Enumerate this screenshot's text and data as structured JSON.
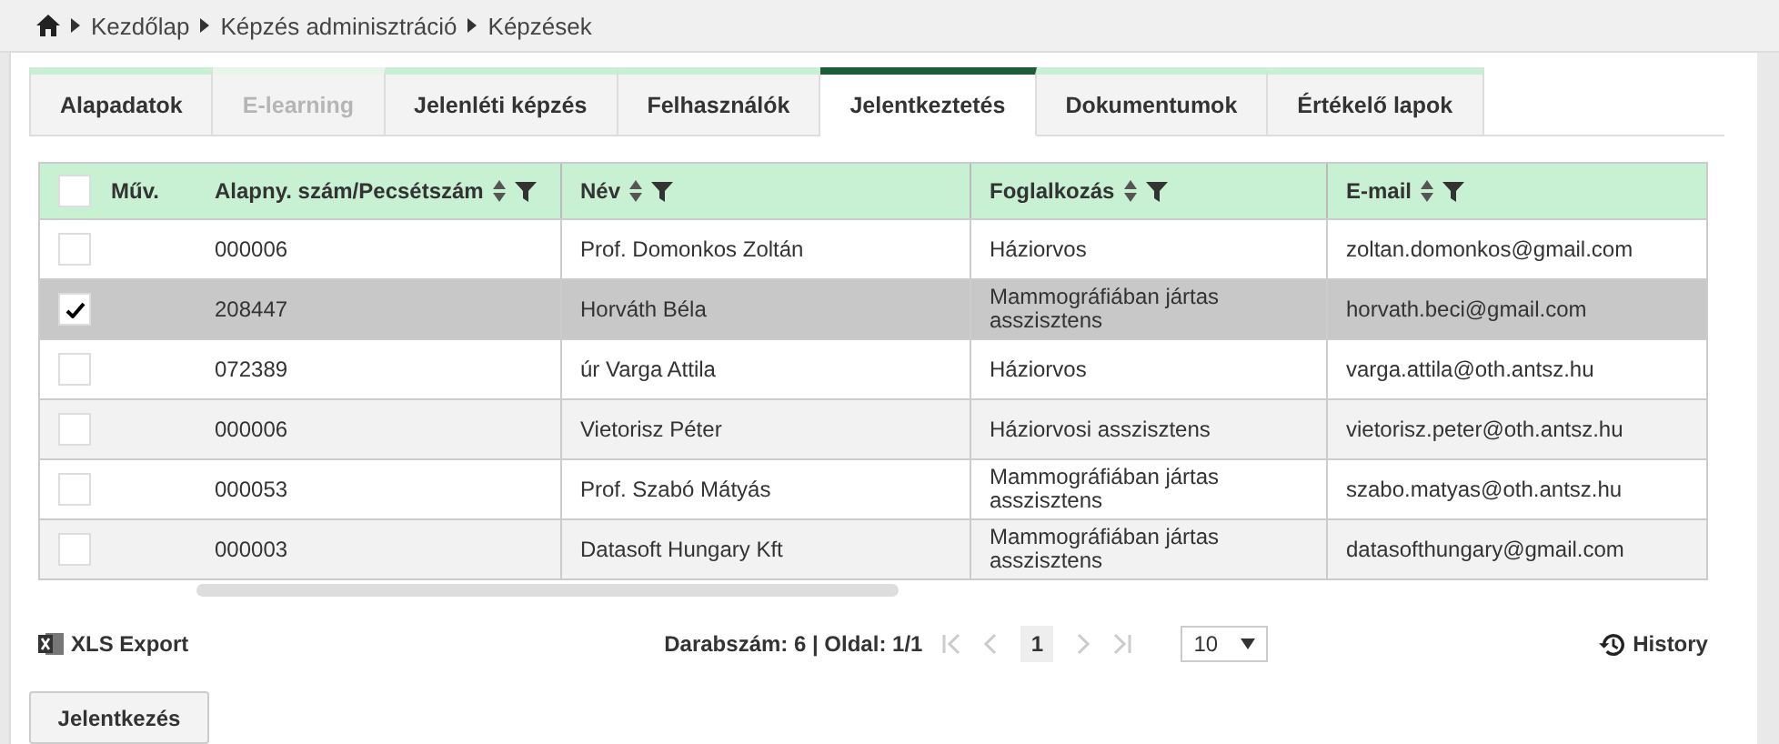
{
  "breadcrumb": [
    "Kezdőlap",
    "Képzés adminisztráció",
    "Képzések"
  ],
  "tabs": [
    {
      "label": "Alapadatok",
      "selected": false,
      "disabled": false
    },
    {
      "label": "E-learning",
      "selected": false,
      "disabled": true
    },
    {
      "label": "Jelenléti képzés",
      "selected": false,
      "disabled": false
    },
    {
      "label": "Felhasználók",
      "selected": false,
      "disabled": false
    },
    {
      "label": "Jelentkeztetés",
      "selected": true,
      "disabled": false
    },
    {
      "label": "Dokumentumok",
      "selected": false,
      "disabled": false
    },
    {
      "label": "Értékelő lapok",
      "selected": false,
      "disabled": false
    }
  ],
  "table": {
    "select_all_checked": false,
    "columns": [
      "Műv.",
      "Alapny. szám/Pecsétszám",
      "Név",
      "Foglalkozás",
      "E-mail"
    ],
    "rows": [
      {
        "checked": false,
        "selected": false,
        "cells": [
          "",
          "000006",
          "Prof. Domonkos Zoltán",
          "Háziorvos",
          "zoltan.domonkos@gmail.com"
        ]
      },
      {
        "checked": true,
        "selected": true,
        "cells": [
          "",
          "208447",
          "Horváth Béla",
          "Mammográfiában jártas asszisztens",
          "horvath.beci@gmail.com"
        ]
      },
      {
        "checked": false,
        "selected": false,
        "cells": [
          "",
          "072389",
          "úr Varga Attila",
          "Háziorvos",
          "varga.attila@oth.antsz.hu"
        ]
      },
      {
        "checked": false,
        "selected": false,
        "cells": [
          "",
          "000006",
          "Vietorisz Péter",
          "Háziorvosi asszisztens",
          "vietorisz.peter@oth.antsz.hu"
        ]
      },
      {
        "checked": false,
        "selected": false,
        "cells": [
          "",
          "000053",
          "Prof. Szabó Mátyás",
          "Mammográfiában jártas asszisztens",
          "szabo.matyas@oth.antsz.hu"
        ]
      },
      {
        "checked": false,
        "selected": false,
        "cells": [
          "",
          "000003",
          "Datasoft Hungary Kft",
          "Mammográfiában jártas asszisztens",
          "datasofthungary@gmail.com"
        ]
      }
    ]
  },
  "footer": {
    "export": "XLS Export",
    "summary": "Darabszám: 6 | Oldal: 1/1",
    "page": "1",
    "page_size": "10",
    "history": "History"
  },
  "buttons": [
    "Jelentkezés"
  ]
}
